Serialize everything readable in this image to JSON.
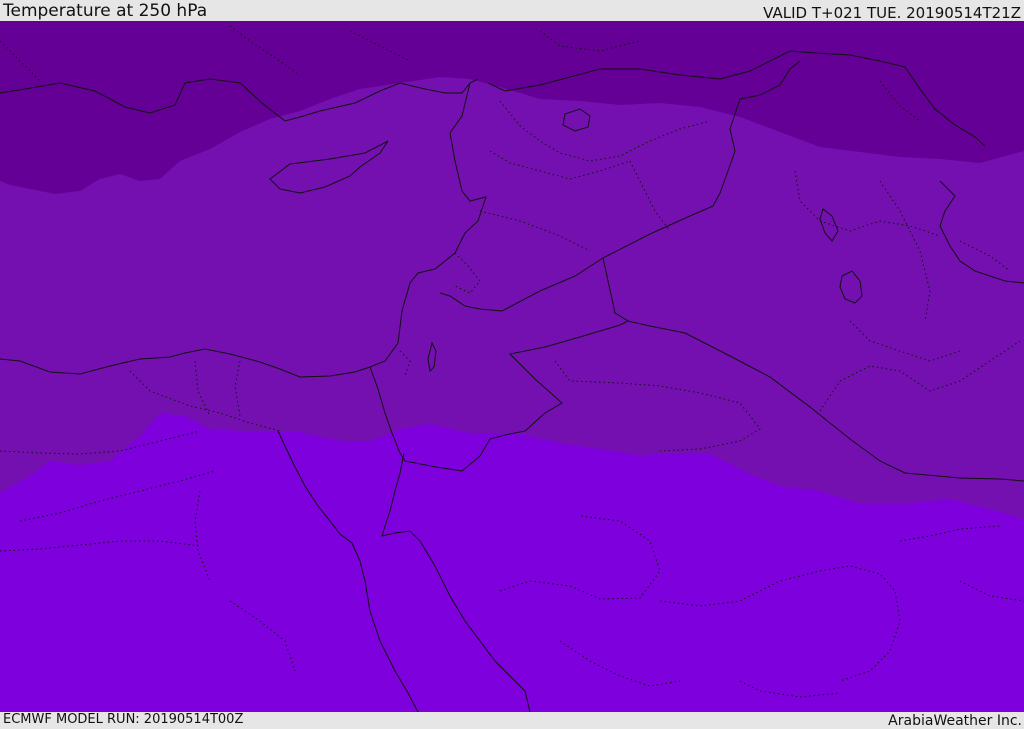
{
  "header": {
    "title": "Temperature at 250 hPa",
    "valid": "VALID T+021 TUE. 20190514T21Z"
  },
  "footer": {
    "model_run": "ECMWF MODEL RUN: 20190514T00Z",
    "credit": "ArabiaWeather Inc."
  },
  "map": {
    "field": "temperature-250hpa",
    "colors": {
      "coldest": "#650096",
      "middle": "#7510b0",
      "warmest": "#7e00dd"
    }
  }
}
